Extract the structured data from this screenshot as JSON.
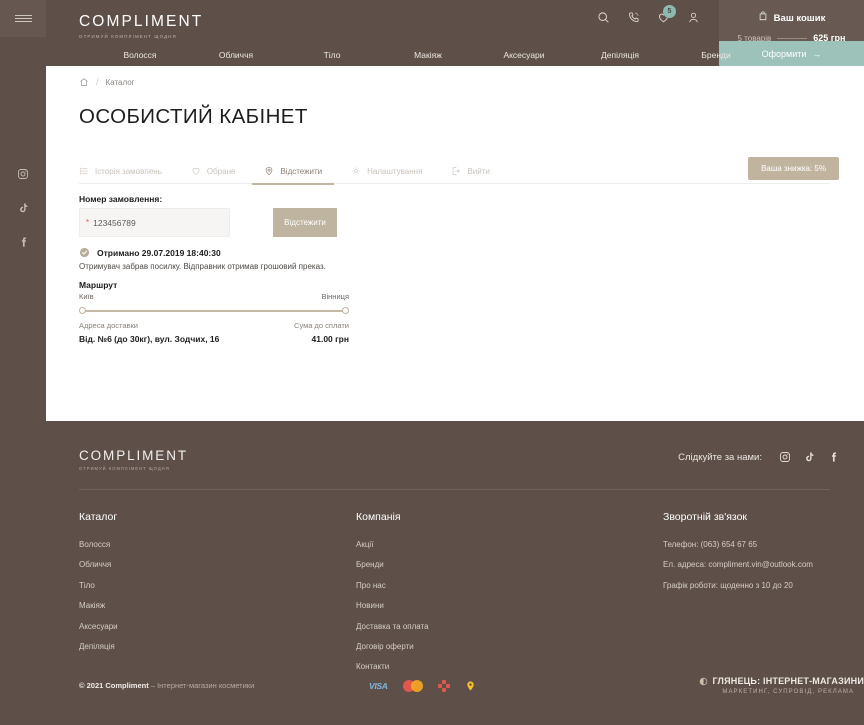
{
  "brand": {
    "wordmark": "COMPLIMENT",
    "tagline": "ОТРИМУЙ КОМПЛІМЕНТ ЩОДНЯ",
    "accent": "#bfb49f",
    "header_bg": "#5e5049",
    "checkout_bg": "#9dc2ba"
  },
  "rail": {
    "socials": [
      {
        "name": "instagram-icon"
      },
      {
        "name": "tiktok-icon"
      },
      {
        "name": "facebook-icon"
      }
    ]
  },
  "header": {
    "icons": [
      {
        "name": "search-icon"
      },
      {
        "name": "phone-icon"
      },
      {
        "name": "heart-icon",
        "badge": "5"
      },
      {
        "name": "user-icon"
      }
    ],
    "cart": {
      "label": "Ваш кошик",
      "count": "5 товарів",
      "sum": "625 грн",
      "checkout_label": "Оформити",
      "checkout_arrow": "→"
    }
  },
  "nav": {
    "items": [
      {
        "label": "Волосся"
      },
      {
        "label": "Обличчя"
      },
      {
        "label": "Тіло"
      },
      {
        "label": "Макіяж"
      },
      {
        "label": "Аксесуари"
      },
      {
        "label": "Депіляція"
      },
      {
        "label": "Бренди"
      }
    ]
  },
  "breadcrumb": {
    "home_icon": "home-icon",
    "separator": "/",
    "current": "Каталог"
  },
  "main": {
    "title": "ОСОБИСТИЙ КАБІНЕТ",
    "tabs": [
      {
        "label": "Історія замовлень",
        "icon": "list-icon",
        "active": false
      },
      {
        "label": "Обране",
        "icon": "heart-icon",
        "active": false
      },
      {
        "label": "Відстежити",
        "icon": "location-pin-icon",
        "active": true
      },
      {
        "label": "Налаштування",
        "icon": "gear-icon",
        "active": false
      },
      {
        "label": "Вийти",
        "icon": "logout-icon",
        "active": false
      }
    ],
    "discount_badge": "Ваша знижка: 5%",
    "form": {
      "label": "Номер замовлення:",
      "required_mark": "*",
      "value": "123456789",
      "placeholder": "Номер замовлення",
      "button": "Відстежити"
    },
    "status": {
      "text": "Отримано 29.07.2019 18:40:30",
      "description": "Отримувач забрав посилку. Відправник отримав грошовий преказ."
    },
    "route": {
      "title": "Маршрут",
      "from": "Київ",
      "to": "Вінниця",
      "address_label": "Адреса доставки",
      "address_value": "Від. №6 (до 30кг), вул. Зодчих, 16",
      "amount_label": "Сума до сплати",
      "amount_value": "41.00 грн"
    }
  },
  "footer": {
    "follow_label": "Слідкуйте за нами:",
    "socials": [
      {
        "name": "instagram-icon"
      },
      {
        "name": "tiktok-icon"
      },
      {
        "name": "facebook-icon"
      }
    ],
    "columns": [
      {
        "title": "Каталог",
        "links": [
          "Волосся",
          "Обличчя",
          "Тіло",
          "Макіяж",
          "Аксесуари",
          "Депіляція"
        ]
      },
      {
        "title": "Компанія",
        "links": [
          "Акції",
          "Бренди",
          "Про нас",
          "Новини",
          "Доставка та оплата",
          "Договір оферти",
          "Контакти"
        ]
      }
    ],
    "contact": {
      "title": "Зворотній зв'язок",
      "lines": [
        "Телефон: (063) 654 67 65",
        "Ел. адреса: compliment.vin@outlook.com",
        "Графік роботи: щоденно з 10 до 20"
      ]
    },
    "copyright_strong": "© 2021 Compliment",
    "copyright_rest": "– Інтернет-магазин косметики",
    "payments": [
      {
        "name": "visa-icon",
        "label": "VISA"
      },
      {
        "name": "mastercard-icon"
      },
      {
        "name": "privat24-icon"
      },
      {
        "name": "liqpay-icon"
      }
    ],
    "made_by": {
      "line1": "ГЛЯНЕЦЬ: ІНТЕРНЕТ-МАГАЗИНИ",
      "line2": "МАРКЕТИНГ, СУПРОВІД, РЕКЛАМА"
    }
  }
}
